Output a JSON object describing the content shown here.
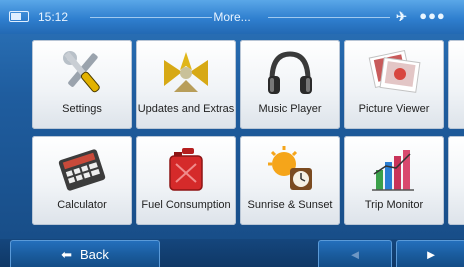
{
  "statusbar": {
    "time": "15:12",
    "title": "More..."
  },
  "tiles": [
    {
      "label": "Settings",
      "icon": "settings-icon"
    },
    {
      "label": "Updates and Extras",
      "icon": "updates-icon"
    },
    {
      "label": "Music Player",
      "icon": "headphones-icon"
    },
    {
      "label": "Picture Viewer",
      "icon": "picture-icon"
    },
    {
      "label": "Calculator",
      "icon": "calculator-icon"
    },
    {
      "label": "Fuel Consumption",
      "icon": "fuel-can-icon"
    },
    {
      "label": "Sunrise & Sunset",
      "icon": "sunrise-clock-icon"
    },
    {
      "label": "Trip Monitor",
      "icon": "bar-chart-icon"
    }
  ],
  "bottom": {
    "back_label": "Back",
    "prev": "◄",
    "next": "►"
  }
}
